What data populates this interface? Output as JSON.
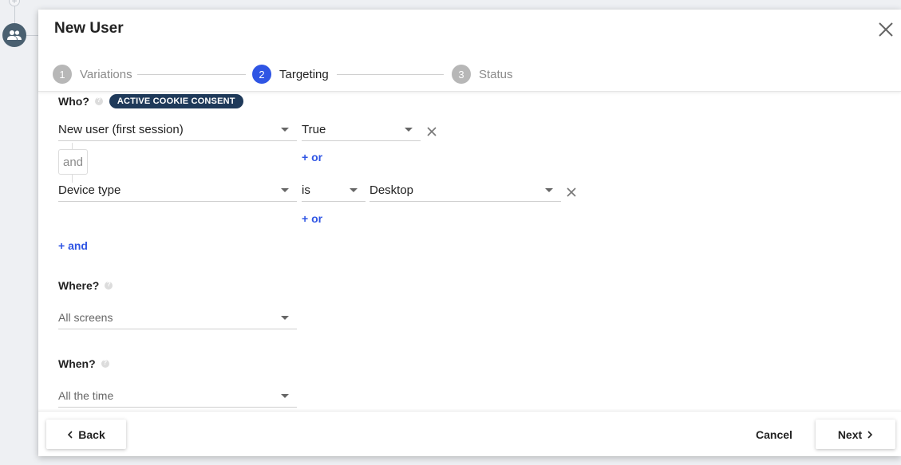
{
  "dialog": {
    "title": "New User"
  },
  "steps": [
    {
      "num": "1",
      "label": "Variations"
    },
    {
      "num": "2",
      "label": "Targeting"
    },
    {
      "num": "3",
      "label": "Status"
    }
  ],
  "who": {
    "label": "Who?",
    "badge": "ACTIVE COOKIE CONSENT",
    "rule1": {
      "attribute": "New user (first session)",
      "value": "True",
      "or_label": "+ or"
    },
    "and_separator": "and",
    "rule2": {
      "attribute": "Device type",
      "operator": "is",
      "value": "Desktop",
      "or_label": "+ or"
    },
    "add_and_label": "+ and"
  },
  "where": {
    "label": "Where?",
    "value": "All screens"
  },
  "when": {
    "label": "When?",
    "value": "All the time"
  },
  "footer": {
    "back_label": "Back",
    "cancel_label": "Cancel",
    "next_label": "Next"
  },
  "colors": {
    "accent": "#2f55e4",
    "badge": "#1f3a5a"
  }
}
